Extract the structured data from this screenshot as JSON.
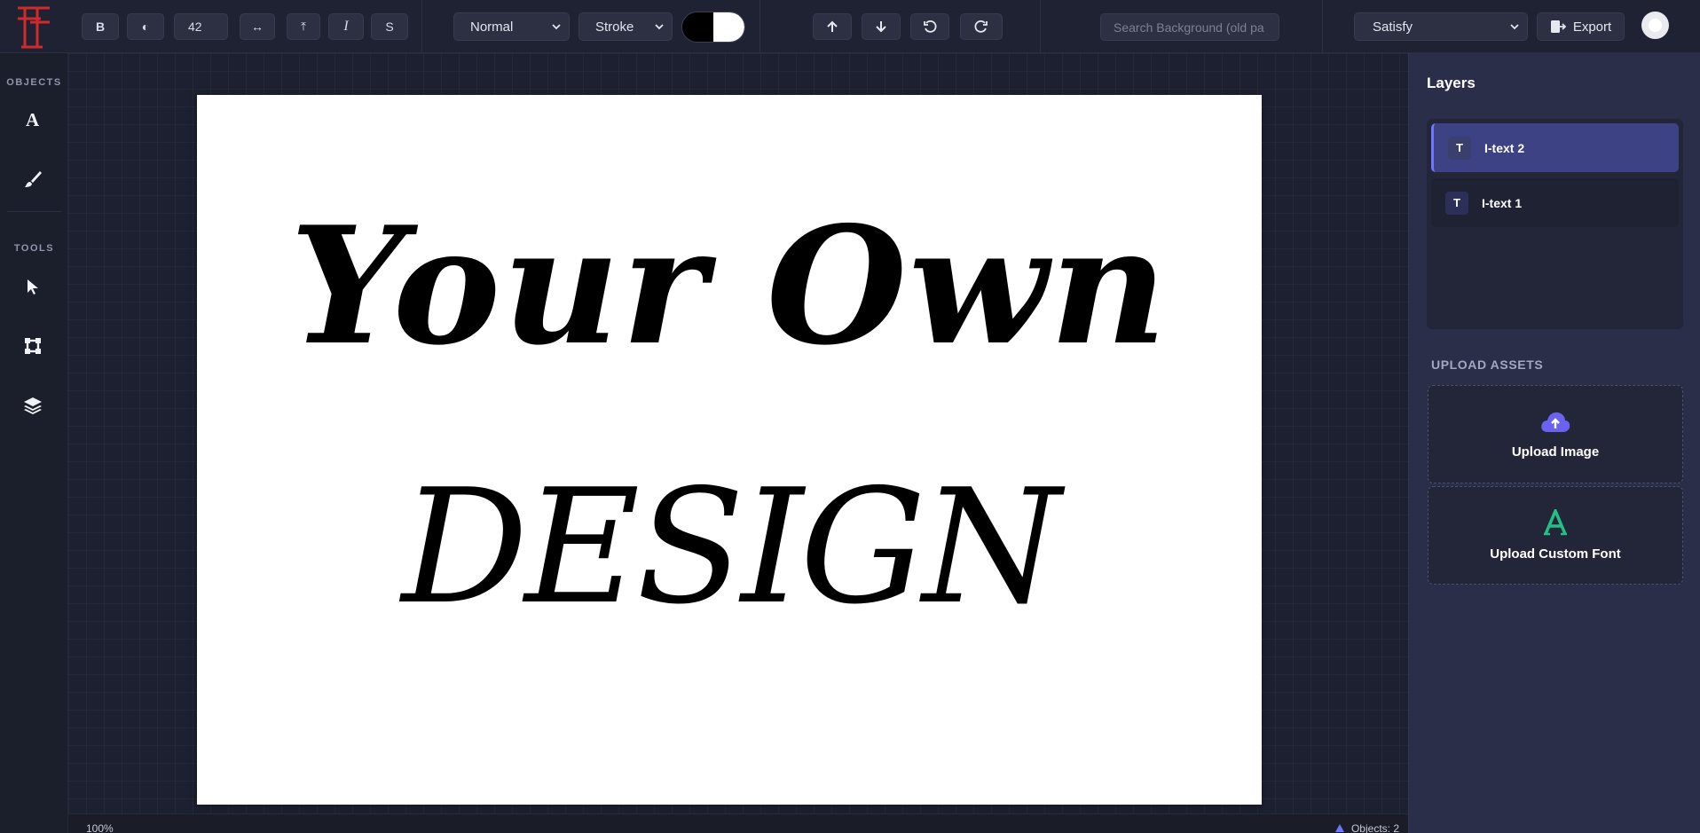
{
  "toolbar": {
    "bold_label": "B",
    "contrast_label": "◐",
    "font_size": "42",
    "spacing_label": "↔",
    "lineheight_label": "⤒",
    "italic_label": "I",
    "strike_label": "S",
    "blend_mode": "Normal",
    "stroke_mode": "Stroke",
    "fill_colors": [
      "#000000",
      "#ffffff"
    ],
    "search_placeholder": "Search Background (old pa",
    "font_family": "Satisfy",
    "export_label": "Export"
  },
  "sidebar": {
    "objects_title": "OBJECTS",
    "tools_title": "TOOLS",
    "object_items": [
      "text-tool",
      "brush-tool"
    ],
    "tool_items": [
      "select-tool",
      "frame-tool",
      "layers-tool"
    ]
  },
  "canvas": {
    "line1": "Your Own",
    "line2": "DESIGN",
    "background": "#ffffff"
  },
  "status": {
    "zoom": "100%",
    "objects": "Objects: 2"
  },
  "layers_panel": {
    "title": "Layers",
    "items": [
      {
        "icon": "T",
        "name": "I-text 2",
        "active": true
      },
      {
        "icon": "T",
        "name": "I-text 1",
        "active": false
      }
    ]
  },
  "upload": {
    "title": "UPLOAD ASSETS",
    "image_label": "Upload Image",
    "font_label": "Upload Custom Font",
    "image_icon_color": "#6b63f0",
    "font_icon_color": "#22c084"
  },
  "brand": {
    "logo_color": "#d02a2a",
    "accent": "#6f76ff"
  }
}
